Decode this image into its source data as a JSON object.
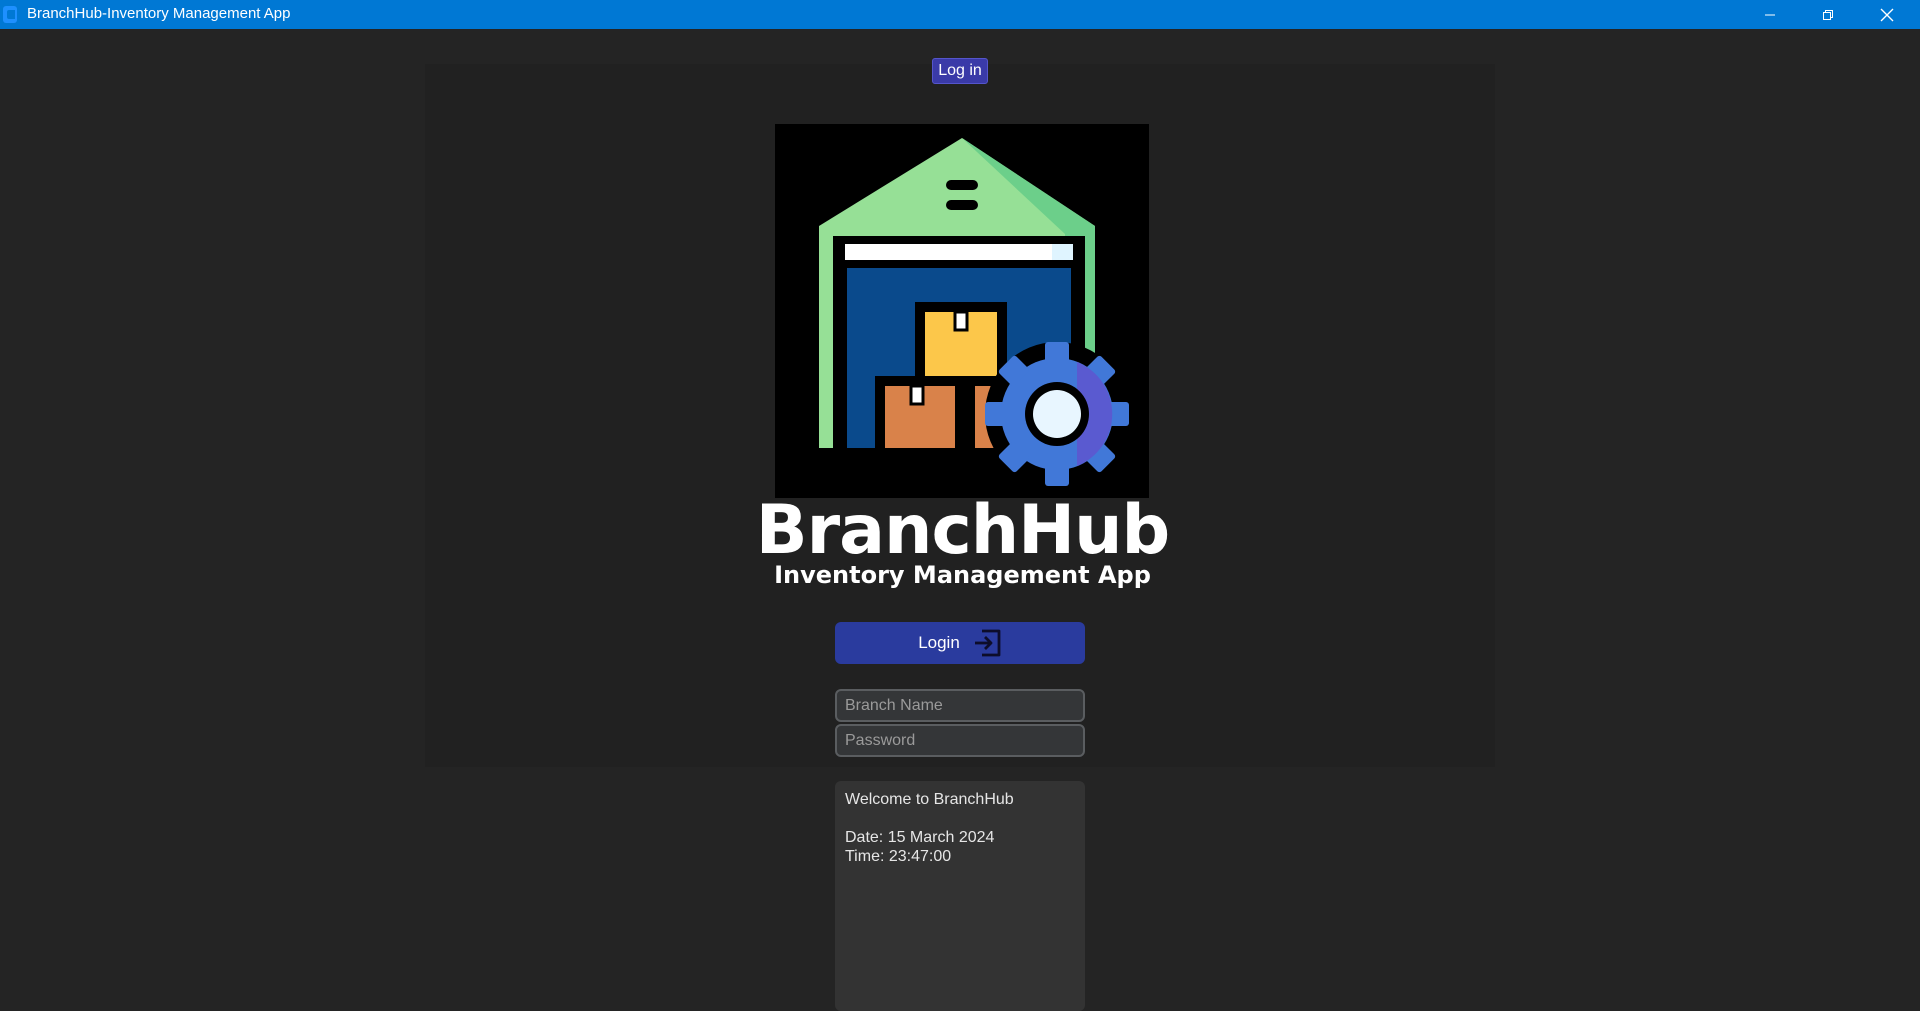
{
  "window": {
    "title": "BranchHub-Inventory Management App"
  },
  "tabs": {
    "login_tab": "Log in"
  },
  "brand": {
    "title": "BranchHub",
    "subtitle": "Inventory Management App"
  },
  "login": {
    "button_label": "Login",
    "branch_placeholder": "Branch Name",
    "branch_value": "",
    "password_placeholder": "Password",
    "password_value": ""
  },
  "info": {
    "welcome": "Welcome to BranchHub",
    "date_line": "Date: 15 March 2024",
    "time_line": "Time: 23:47:00"
  },
  "icons": {
    "app": "app-icon",
    "minimize": "minimize-icon",
    "restore": "restore-icon",
    "close": "close-icon",
    "login": "login-arrow-icon",
    "logo": "warehouse-gear-logo"
  },
  "colors": {
    "titlebar": "#0078d4",
    "background": "#242424",
    "panel": "#212121",
    "accent": "#2a3b9e",
    "tab": "#3a3aa8"
  }
}
